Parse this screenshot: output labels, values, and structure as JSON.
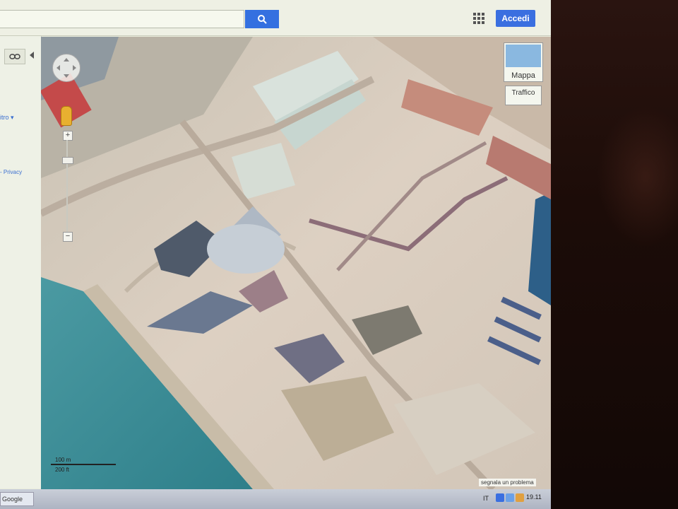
{
  "topbar": {
    "search": {
      "value": "",
      "placeholder": ""
    },
    "search_icon": "search-icon",
    "apps_icon": "apps-grid-icon",
    "signin_label": "Accedi"
  },
  "leftpanel": {
    "filter_label": "itro ▾",
    "privacy_label": "- Privacy"
  },
  "map": {
    "mapmode_label": "Mappa",
    "traffic_label": "Traffico",
    "scale_metric": "100 m",
    "scale_imperial": "200 ft",
    "report_label": "segnala un problema"
  },
  "taskbar": {
    "start_label": "Google",
    "language": "IT",
    "clock": "19.11"
  },
  "colors": {
    "accent_blue": "#3470e0",
    "water": "#3f8f98"
  }
}
